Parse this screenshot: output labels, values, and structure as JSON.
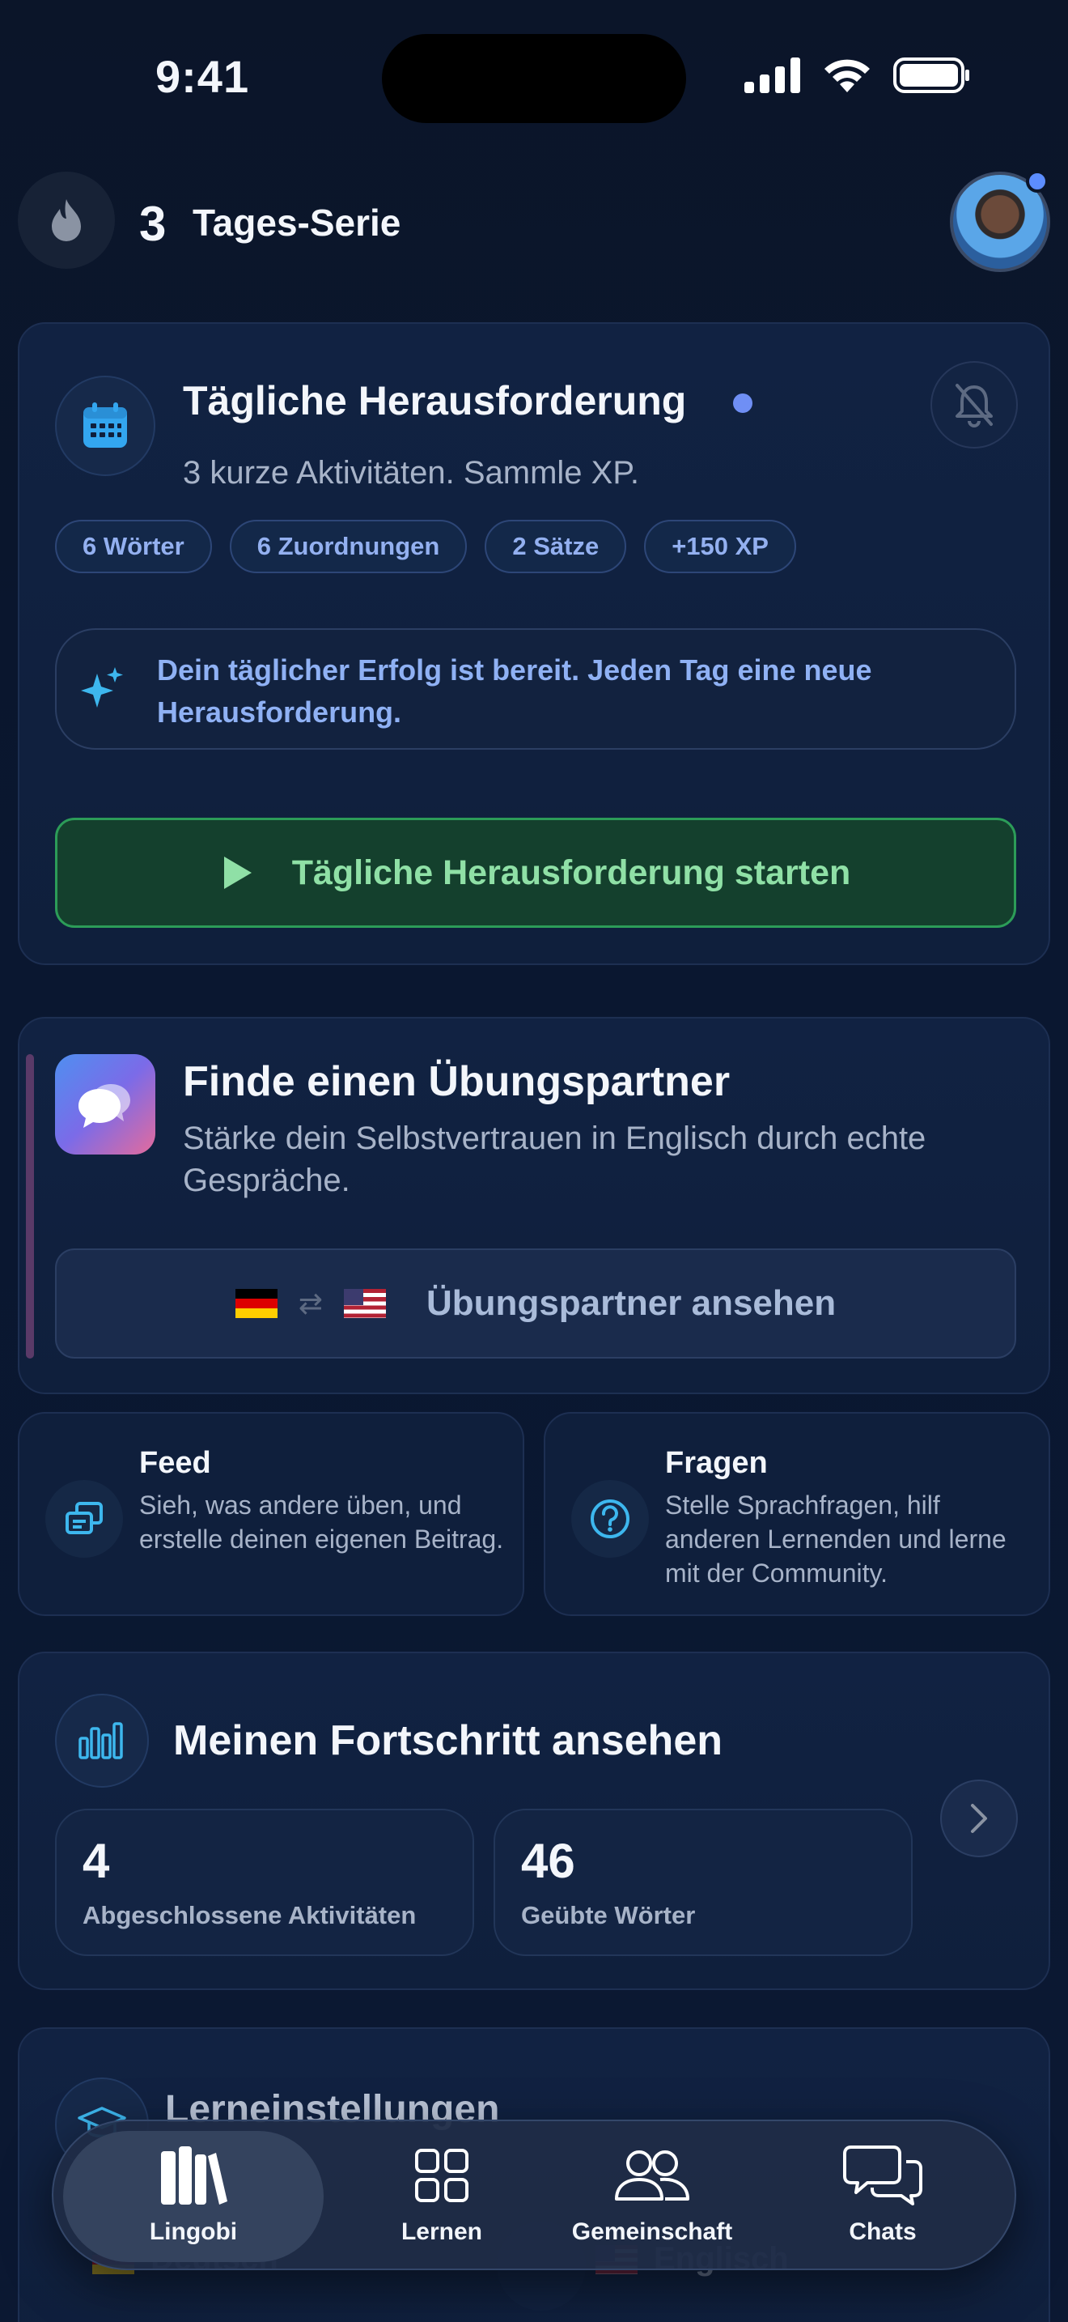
{
  "status_bar": {
    "time": "9:41"
  },
  "streak": {
    "count": "3",
    "label": "Tages-Serie"
  },
  "daily": {
    "title": "Tägliche Herausforderung",
    "subtitle": "3 kurze Aktivitäten. Sammle XP.",
    "chips": [
      "6 Wörter",
      "6 Zuordnungen",
      "2 Sätze",
      "+150 XP"
    ],
    "notice": "Dein täglicher Erfolg ist bereit. Jeden Tag eine neue Herausforderung.",
    "start_label": "Tägliche Herausforderung starten"
  },
  "partner": {
    "title": "Finde einen Übungspartner",
    "subtitle": "Stärke dein Selbstvertrauen in Englisch durch echte Gespräche.",
    "button_label": "Übungspartner ansehen"
  },
  "feed": {
    "title": "Feed",
    "desc": "Sieh, was andere üben, und erstelle deinen eigenen Beitrag."
  },
  "questions": {
    "title": "Fragen",
    "desc": "Stelle Sprachfragen, hilf anderen Lernenden und lerne mit der Community."
  },
  "progress": {
    "title": "Meinen Fortschritt ansehen",
    "stats": [
      {
        "value": "4",
        "label": "Abgeschlossene Aktivitäten"
      },
      {
        "value": "46",
        "label": "Geübte Wörter"
      }
    ]
  },
  "settings": {
    "title": "Lerneinstellungen",
    "from_lang": "Deutsch",
    "to_lang": "Englisch"
  },
  "tabbar": {
    "tabs": [
      {
        "label": "Lingobi",
        "icon": "library-icon",
        "active": true
      },
      {
        "label": "Lernen",
        "icon": "grid-icon",
        "active": false
      },
      {
        "label": "Gemeinschaft",
        "icon": "people-icon",
        "active": false
      },
      {
        "label": "Chats",
        "icon": "chat-bubbles-icon",
        "active": false
      }
    ]
  },
  "colors": {
    "background": "#0a1428",
    "accent_blue": "#6f8ff5",
    "success_green": "#2c9c58",
    "success_text": "#8fe0a6",
    "chip_text": "#93b0f0"
  }
}
